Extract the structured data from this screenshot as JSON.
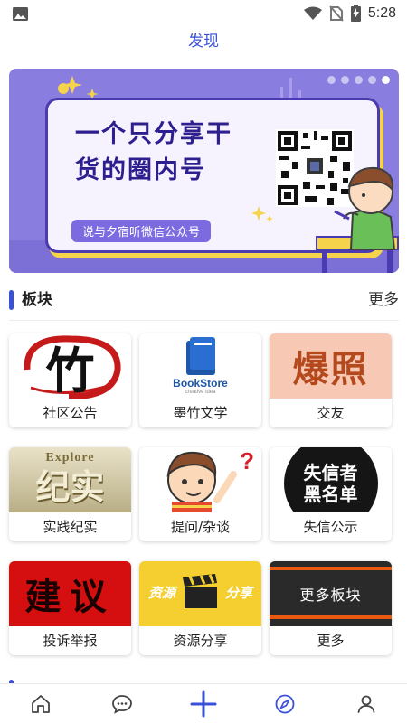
{
  "status_bar": {
    "time": "5:28",
    "icons": [
      "gallery-icon",
      "wifi-icon",
      "no-sim-icon",
      "battery-charging-icon"
    ]
  },
  "header": {
    "title": "发现"
  },
  "banner": {
    "headline": "一个只分享干货的圈内号",
    "subline": "说与夕宿听微信公众号",
    "slides": 5,
    "active_slide": 5
  },
  "section": {
    "title": "板块",
    "more_label": "更多"
  },
  "tiles": [
    {
      "label": "社区公告",
      "thumb_text": "竹"
    },
    {
      "label": "墨竹文学",
      "thumb_text": "BookStore",
      "thumb_sub": "creative idea"
    },
    {
      "label": "交友",
      "thumb_text": "爆照"
    },
    {
      "label": "实践纪实",
      "thumb_text": "纪实",
      "thumb_top": "Explore"
    },
    {
      "label": "提问/杂谈",
      "thumb_text": "?"
    },
    {
      "label": "失信公示",
      "thumb_text": "失信者黑名单"
    },
    {
      "label": "投诉举报",
      "thumb_text": "建议"
    },
    {
      "label": "资源分享",
      "thumb_text": "资源",
      "thumb_text2": "分享"
    },
    {
      "label": "更多",
      "thumb_text": "更多板块"
    }
  ],
  "bottom_nav": [
    "home-icon",
    "message-icon",
    "add-icon",
    "discover-icon",
    "profile-icon"
  ],
  "colors": {
    "accent": "#3A50D9",
    "banner_bg": "#8A7DE0"
  }
}
